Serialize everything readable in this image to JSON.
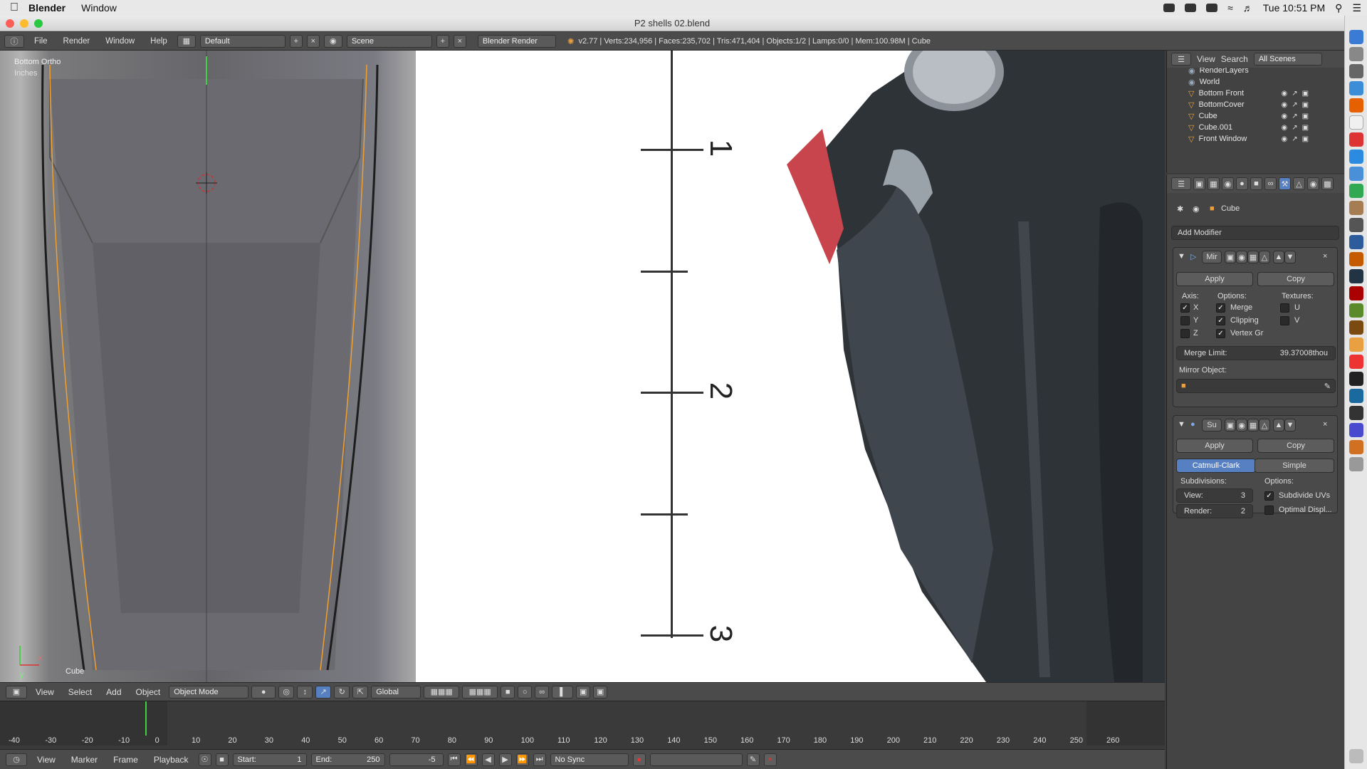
{
  "menubar": {
    "app_name": "Blender",
    "window_menu": "Window",
    "clock": "Tue 10:51 PM"
  },
  "window": {
    "title": "P2 shells 02.blend"
  },
  "info_header": {
    "menus": [
      "File",
      "Render",
      "Window",
      "Help"
    ],
    "layout_field": "Default",
    "scene_field": "Scene",
    "engine": "Blender Render",
    "stats": "v2.77 | Verts:234,956 | Faces:235,702 | Tris:471,404 | Objects:1/2 | Lamps:0/0 | Mem:100.98M | Cube"
  },
  "viewport": {
    "view_name": "Bottom Ortho",
    "unit_label": "Inches",
    "axis_x": "x",
    "axis_y": "y",
    "object_name": "Cube",
    "ruler_labels": [
      "1",
      "2",
      "3"
    ]
  },
  "viewport_header": {
    "menus": [
      "View",
      "Select",
      "Add",
      "Object"
    ],
    "mode": "Object Mode",
    "orientation": "Global"
  },
  "timeline": {
    "frame_numbers": [
      "-40",
      "-30",
      "-20",
      "-10",
      "0",
      "10",
      "20",
      "30",
      "40",
      "50",
      "60",
      "70",
      "80",
      "90",
      "100",
      "110",
      "120",
      "130",
      "140",
      "150",
      "160",
      "170",
      "180",
      "190",
      "200",
      "210",
      "220",
      "230",
      "240",
      "250",
      "260"
    ],
    "menus": [
      "View",
      "Marker",
      "Frame",
      "Playback"
    ],
    "start_label": "Start:",
    "start_value": "1",
    "end_label": "End:",
    "end_value": "250",
    "current_frame": "-5",
    "sync": "No Sync"
  },
  "outliner": {
    "menus": [
      "View",
      "Search"
    ],
    "scope": "All Scenes",
    "items": [
      {
        "name": "RenderLayers"
      },
      {
        "name": "World"
      },
      {
        "name": "Bottom Front"
      },
      {
        "name": "BottomCover"
      },
      {
        "name": "Cube"
      },
      {
        "name": "Cube.001"
      },
      {
        "name": "Front Window"
      }
    ]
  },
  "properties": {
    "context_object": "Cube",
    "add_modifier": "Add Modifier",
    "mirror": {
      "name": "Mir",
      "apply": "Apply",
      "copy": "Copy",
      "axis_label": "Axis:",
      "options_label": "Options:",
      "textures_label": "Textures:",
      "axis": [
        {
          "label": "X",
          "checked": true
        },
        {
          "label": "Y",
          "checked": false
        },
        {
          "label": "Z",
          "checked": false
        }
      ],
      "options": [
        {
          "label": "Merge",
          "checked": true
        },
        {
          "label": "Clipping",
          "checked": true
        },
        {
          "label": "Vertex Gr",
          "checked": true
        }
      ],
      "textures": [
        {
          "label": "U",
          "checked": false
        },
        {
          "label": "V",
          "checked": false
        }
      ],
      "merge_limit_label": "Merge Limit:",
      "merge_limit_value": "39.37008thou",
      "mirror_object_label": "Mirror Object:"
    },
    "subsurf": {
      "name": "Su",
      "apply": "Apply",
      "copy": "Copy",
      "tab_catmull": "Catmull-Clark",
      "tab_simple": "Simple",
      "subdivisions_label": "Subdivisions:",
      "options_label": "Options:",
      "view_label": "View:",
      "view_value": "3",
      "render_label": "Render:",
      "render_value": "2",
      "subdivide_uvs": "Subdivide UVs",
      "subdivide_uvs_checked": true,
      "optimal_display": "Optimal Displ...",
      "optimal_display_checked": false
    }
  },
  "colors": {
    "accent_blue": "#5680c2",
    "bg_dark": "#3c3c3c",
    "selection_orange": "#f0a030"
  }
}
